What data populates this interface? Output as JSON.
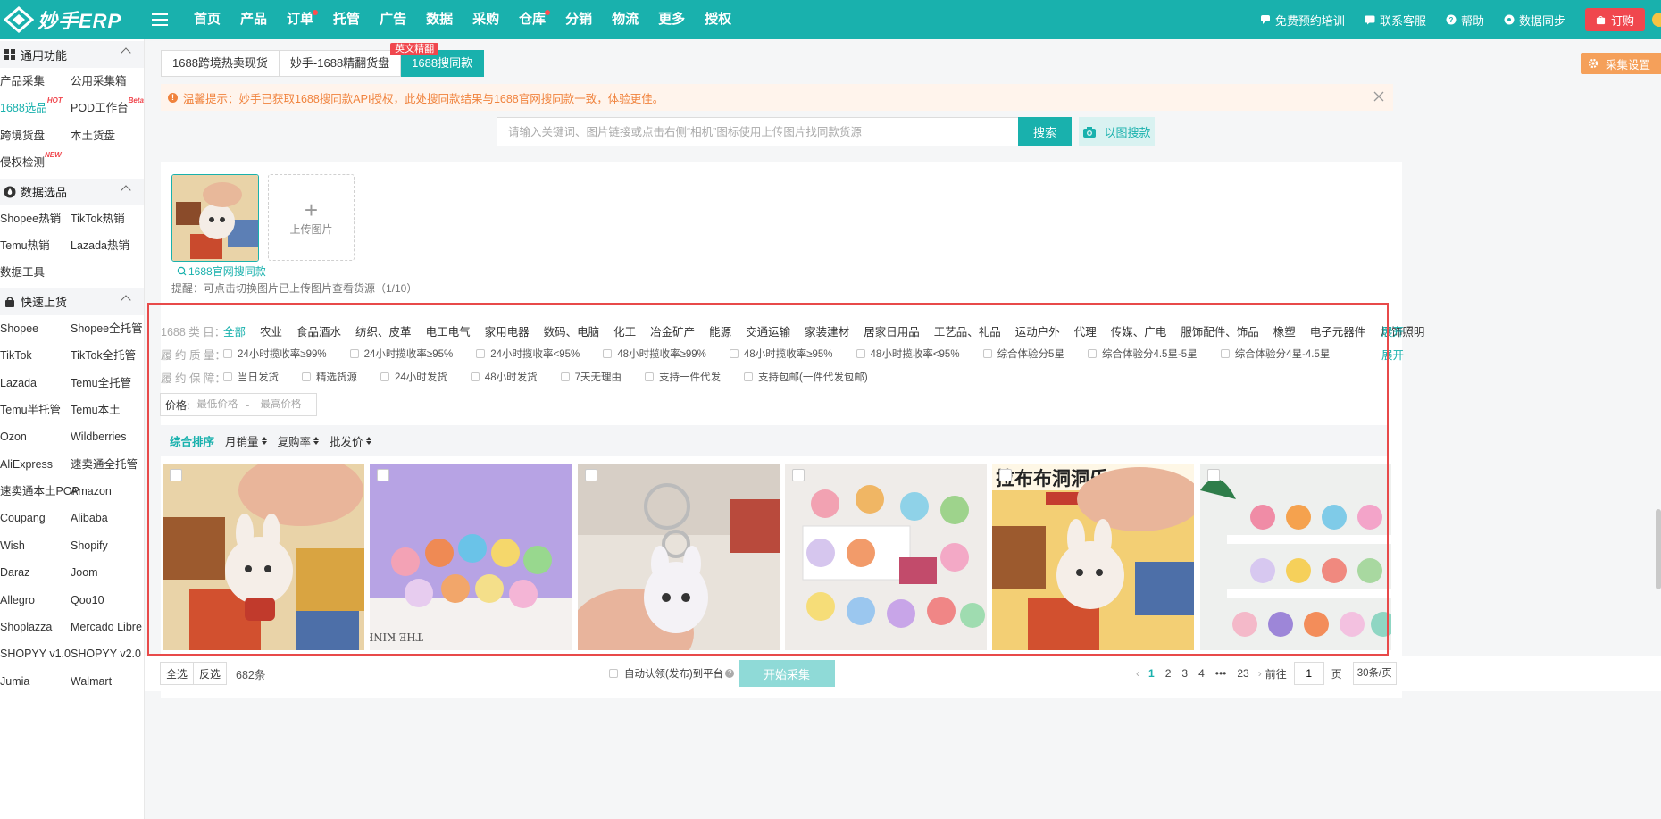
{
  "brand": {
    "name": "妙手ERP"
  },
  "nav": {
    "items": [
      {
        "label": "首页",
        "dot": false
      },
      {
        "label": "产品",
        "dot": false
      },
      {
        "label": "订单",
        "dot": true
      },
      {
        "label": "托管",
        "dot": false
      },
      {
        "label": "广告",
        "dot": false
      },
      {
        "label": "数据",
        "dot": false
      },
      {
        "label": "采购",
        "dot": false
      },
      {
        "label": "仓库",
        "dot": true
      },
      {
        "label": "分销",
        "dot": false
      },
      {
        "label": "物流",
        "dot": false
      },
      {
        "label": "更多",
        "dot": false
      },
      {
        "label": "授权",
        "dot": false
      }
    ],
    "right": {
      "training": "免费预约培训",
      "service": "联系客服",
      "help": "帮助",
      "sync": "数据同步",
      "order": "订购"
    }
  },
  "sidebar": {
    "groups": [
      {
        "title": "通用功能",
        "icon": "grid-icon",
        "items": [
          {
            "label": "产品采集",
            "sup": ""
          },
          {
            "label": "公用采集箱",
            "sup": ""
          },
          {
            "label": "1688选品",
            "sup": "HOT",
            "active": true
          },
          {
            "label": "POD工作台",
            "sup": "Beta"
          },
          {
            "label": "跨境货盘",
            "sup": ""
          },
          {
            "label": "本土货盘",
            "sup": ""
          },
          {
            "label": "侵权检测",
            "sup": "NEW"
          }
        ]
      },
      {
        "title": "数据选品",
        "icon": "fire-icon",
        "items": [
          {
            "label": "Shopee热销",
            "sup": ""
          },
          {
            "label": "TikTok热销",
            "sup": ""
          },
          {
            "label": "Temu热销",
            "sup": ""
          },
          {
            "label": "Lazada热销",
            "sup": ""
          },
          {
            "label": "数据工具",
            "sup": ""
          }
        ]
      },
      {
        "title": "快速上货",
        "icon": "bag-icon",
        "items": [
          {
            "label": "Shopee",
            "sup": ""
          },
          {
            "label": "Shopee全托管",
            "sup": ""
          },
          {
            "label": "TikTok",
            "sup": ""
          },
          {
            "label": "TikTok全托管",
            "sup": ""
          },
          {
            "label": "Lazada",
            "sup": ""
          },
          {
            "label": "Temu全托管",
            "sup": ""
          },
          {
            "label": "Temu半托管",
            "sup": ""
          },
          {
            "label": "Temu本土",
            "sup": ""
          },
          {
            "label": "Ozon",
            "sup": ""
          },
          {
            "label": "Wildberries",
            "sup": ""
          },
          {
            "label": "AliExpress",
            "sup": ""
          },
          {
            "label": "速卖通全托管",
            "sup": ""
          },
          {
            "label": "速卖通本土POP",
            "sup": ""
          },
          {
            "label": "Amazon",
            "sup": ""
          },
          {
            "label": "Coupang",
            "sup": ""
          },
          {
            "label": "Alibaba",
            "sup": ""
          },
          {
            "label": "Wish",
            "sup": ""
          },
          {
            "label": "Shopify",
            "sup": ""
          },
          {
            "label": "Daraz",
            "sup": ""
          },
          {
            "label": "Joom",
            "sup": ""
          },
          {
            "label": "Allegro",
            "sup": ""
          },
          {
            "label": "Qoo10",
            "sup": ""
          },
          {
            "label": "Shoplazza",
            "sup": ""
          },
          {
            "label": "Mercado Libre",
            "sup": ""
          },
          {
            "label": "SHOPYY v1.0",
            "sup": ""
          },
          {
            "label": "SHOPYY v2.0",
            "sup": ""
          },
          {
            "label": "Jumia",
            "sup": ""
          },
          {
            "label": "Walmart",
            "sup": ""
          }
        ]
      }
    ]
  },
  "tabs": {
    "items": [
      "1688跨境热卖现货",
      "妙手-1688精翻货盘",
      "1688搜同款"
    ],
    "active_index": 2,
    "badge": "英文精翻"
  },
  "collect_settings": "采集设置",
  "notice": "温馨提示：妙手已获取1688搜同款API授权，此处搜同款结果与1688官网搜同款一致，体验更佳。",
  "search": {
    "placeholder": "请输入关键词、图片链接或点击右侧“相机”图标使用上传图片找同款货源",
    "value": "",
    "button": "搜索",
    "image_button": "以图搜款"
  },
  "upload": {
    "add_label": "上传图片",
    "thumb_caption": "1688官网搜同款",
    "hint": "提醒：可点击切换图片已上传图片查看货源（1/10）"
  },
  "filters": {
    "category_label": "1688 类 目：",
    "categories": [
      "全部",
      "农业",
      "食品酒水",
      "纺织、皮革",
      "电工电气",
      "家用电器",
      "数码、电脑",
      "化工",
      "冶金矿产",
      "能源",
      "交通运输",
      "家装建材",
      "居家日用品",
      "工艺品、礼品",
      "运动户外",
      "代理",
      "传媒、广电",
      "服饰配件、饰品",
      "橡塑",
      "电子元器件",
      "灯饰照明"
    ],
    "quality_label": "履 约 质 量：",
    "quality_options": [
      "24小时揽收率≥99%",
      "24小时揽收率≥95%",
      "24小时揽收率<95%",
      "48小时揽收率≥99%",
      "48小时揽收率≥95%",
      "48小时揽收率<95%",
      "综合体验分5星",
      "综合体验分4.5星-5星",
      "综合体验分4星-4.5星"
    ],
    "guarantee_label": "履 约 保 障：",
    "guarantee_options": [
      "当日发货",
      "精选货源",
      "24小时发货",
      "48小时发货",
      "7天无理由",
      "支持一件代发",
      "支持包邮(一件代发包邮)"
    ],
    "expand": "展开"
  },
  "price": {
    "label": "价格:",
    "min_placeholder": "最低价格",
    "max_placeholder": "最高价格",
    "separator": "-"
  },
  "sort": {
    "items": [
      {
        "label": "综合排序",
        "active": true,
        "arrows": false
      },
      {
        "label": "月销量",
        "active": false,
        "arrows": true
      },
      {
        "label": "复购率",
        "active": false,
        "arrows": true
      },
      {
        "label": "批发价",
        "active": false,
        "arrows": true
      }
    ]
  },
  "products": [
    {
      "bg": "#e9d3a8"
    },
    {
      "bg": "#b7a3e4"
    },
    {
      "bg": "#e8e2da"
    },
    {
      "bg": "#efece9"
    },
    {
      "bg": "#f3cf74",
      "overlay": "拉布布洞洞乐"
    },
    {
      "bg": "#eef0ee"
    }
  ],
  "bottom": {
    "select_all": "全选",
    "invert": "反选",
    "count": "682条",
    "auto_claim": "自动认领(发布)到平台",
    "start": "开始采集",
    "pages": [
      "1",
      "2",
      "3",
      "4",
      "•••",
      "23"
    ],
    "goto_label": "前往",
    "goto_value": "1",
    "page_unit": "页",
    "per_page": "30条/页"
  }
}
